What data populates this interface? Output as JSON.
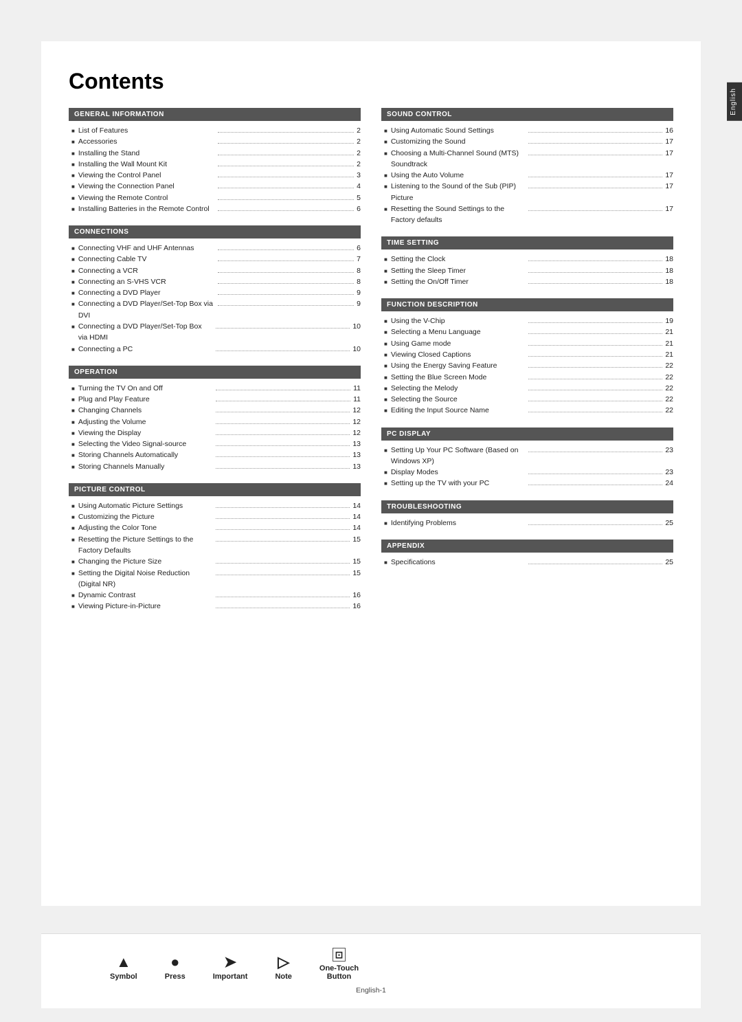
{
  "page": {
    "title": "Contents",
    "side_tab": "English",
    "page_number": "English-1"
  },
  "legend": {
    "items": [
      {
        "symbol": "▲",
        "label": "Symbol"
      },
      {
        "symbol": "●",
        "label": "Press"
      },
      {
        "symbol": "➤",
        "label": "Important"
      },
      {
        "symbol": "☐",
        "label": "Note"
      },
      {
        "symbol": "⊡",
        "label": "One-Touch\nButton"
      }
    ]
  },
  "sections_left": [
    {
      "header": "GENERAL INFORMATION",
      "items": [
        {
          "text": "List of Features",
          "page": "2"
        },
        {
          "text": "Accessories",
          "page": "2"
        },
        {
          "text": "Installing the Stand",
          "page": "2"
        },
        {
          "text": "Installing the Wall Mount Kit",
          "page": "2"
        },
        {
          "text": "Viewing the Control Panel",
          "page": "3"
        },
        {
          "text": "Viewing the Connection Panel",
          "page": "4"
        },
        {
          "text": "Viewing the Remote Control",
          "page": "5"
        },
        {
          "text": "Installing Batteries in the Remote Control",
          "page": "6"
        }
      ]
    },
    {
      "header": "CONNECTIONS",
      "items": [
        {
          "text": "Connecting VHF and UHF Antennas",
          "page": "6"
        },
        {
          "text": "Connecting Cable TV",
          "page": "7"
        },
        {
          "text": "Connecting a VCR",
          "page": "8"
        },
        {
          "text": "Connecting an S-VHS VCR",
          "page": "8"
        },
        {
          "text": "Connecting a DVD Player",
          "page": "9"
        },
        {
          "text": "Connecting a DVD Player/Set-Top Box via DVI",
          "page": "9"
        },
        {
          "text": "Connecting a DVD Player/Set-Top Box via HDMI",
          "page": "10"
        },
        {
          "text": "Connecting a PC",
          "page": "10"
        }
      ]
    },
    {
      "header": "OPERATION",
      "items": [
        {
          "text": "Turning the TV On and Off",
          "page": "11"
        },
        {
          "text": "Plug and Play Feature",
          "page": "11"
        },
        {
          "text": "Changing Channels",
          "page": "12"
        },
        {
          "text": "Adjusting the Volume",
          "page": "12"
        },
        {
          "text": "Viewing the Display",
          "page": "12"
        },
        {
          "text": "Selecting the Video Signal-source",
          "page": "13"
        },
        {
          "text": "Storing Channels Automatically",
          "page": "13"
        },
        {
          "text": "Storing Channels Manually",
          "page": "13"
        }
      ]
    },
    {
      "header": "PICTURE CONTROL",
      "items": [
        {
          "text": "Using Automatic Picture Settings",
          "page": "14"
        },
        {
          "text": "Customizing the Picture",
          "page": "14"
        },
        {
          "text": "Adjusting the Color Tone",
          "page": "14"
        },
        {
          "text": "Resetting the Picture Settings to the Factory Defaults",
          "page": "15"
        },
        {
          "text": "Changing the Picture Size",
          "page": "15"
        },
        {
          "text": "Setting the Digital Noise Reduction (Digital NR)",
          "page": "15"
        },
        {
          "text": "Dynamic Contrast",
          "page": "16"
        },
        {
          "text": "Viewing Picture-in-Picture",
          "page": "16"
        }
      ]
    }
  ],
  "sections_right": [
    {
      "header": "SOUND CONTROL",
      "items": [
        {
          "text": "Using Automatic Sound Settings",
          "page": "16"
        },
        {
          "text": "Customizing the Sound",
          "page": "17"
        },
        {
          "text": "Choosing a Multi-Channel Sound (MTS) Soundtrack",
          "page": "17"
        },
        {
          "text": "Using the Auto Volume",
          "page": "17"
        },
        {
          "text": "Listening to the Sound of the Sub (PIP) Picture",
          "page": "17"
        },
        {
          "text": "Resetting the Sound Settings to the Factory defaults",
          "page": "17"
        }
      ]
    },
    {
      "header": "TIME SETTING",
      "items": [
        {
          "text": "Setting the Clock",
          "page": "18"
        },
        {
          "text": "Setting the Sleep Timer",
          "page": "18"
        },
        {
          "text": "Setting the On/Off Timer",
          "page": "18"
        }
      ]
    },
    {
      "header": "FUNCTION DESCRIPTION",
      "items": [
        {
          "text": "Using the V-Chip",
          "page": "19"
        },
        {
          "text": "Selecting a Menu Language",
          "page": "21"
        },
        {
          "text": "Using Game mode",
          "page": "21"
        },
        {
          "text": "Viewing Closed Captions",
          "page": "21"
        },
        {
          "text": "Using the Energy Saving Feature",
          "page": "22"
        },
        {
          "text": "Setting the Blue Screen Mode",
          "page": "22"
        },
        {
          "text": "Selecting the Melody",
          "page": "22"
        },
        {
          "text": "Selecting the Source",
          "page": "22"
        },
        {
          "text": "Editing the Input Source Name",
          "page": "22"
        }
      ]
    },
    {
      "header": "PC DISPLAY",
      "items": [
        {
          "text": "Setting Up Your PC Software (Based on Windows XP)",
          "page": "23"
        },
        {
          "text": "Display Modes",
          "page": "23"
        },
        {
          "text": "Setting up the TV with your PC",
          "page": "24"
        }
      ]
    },
    {
      "header": "TROUBLESHOOTING",
      "items": [
        {
          "text": "Identifying Problems",
          "page": "25"
        }
      ]
    },
    {
      "header": "APPENDIX",
      "items": [
        {
          "text": "Specifications",
          "page": "25"
        }
      ]
    }
  ]
}
